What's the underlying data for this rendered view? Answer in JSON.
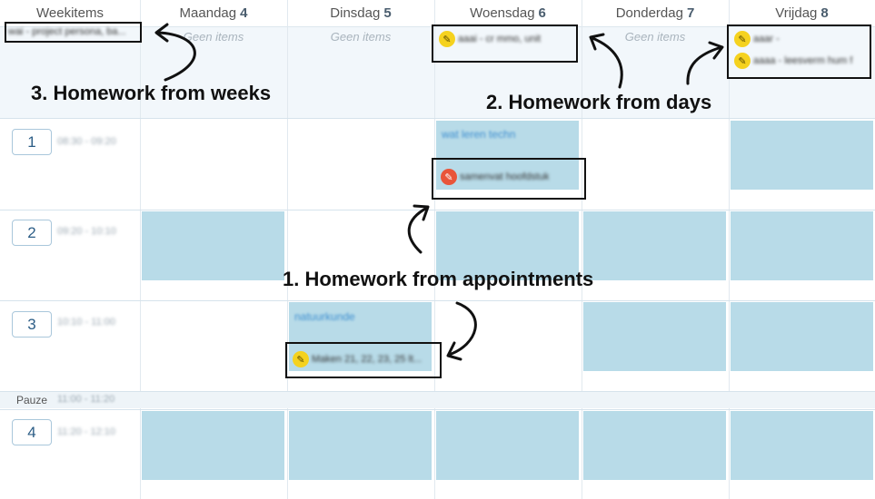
{
  "header": {
    "weekitems": "Weekitems",
    "days": [
      {
        "name": "Maandag",
        "num": "4"
      },
      {
        "name": "Dinsdag",
        "num": "5"
      },
      {
        "name": "Woensdag",
        "num": "6"
      },
      {
        "name": "Donderdag",
        "num": "7"
      },
      {
        "name": "Vrijdag",
        "num": "8"
      }
    ]
  },
  "week_homework": "wai - project persona, ba...",
  "empty_label": "Geen items",
  "day_homework": {
    "woensdag": "aaai - cr mmo, unit",
    "vrijdag": [
      "aaar -",
      "aaaa - leesverm hum f"
    ]
  },
  "periods": [
    {
      "num": "1",
      "time": "08:30 - 09:20"
    },
    {
      "num": "2",
      "time": "09:20 - 10:10"
    },
    {
      "num": "3",
      "time": "10:10 - 11:00"
    },
    {
      "num": "4",
      "time": "11:20 - 12:10"
    }
  ],
  "pauze": {
    "label": "Pauze",
    "time": "11:00 - 11:20"
  },
  "appointments": {
    "woensdag_1_title": "wat leren techn",
    "woensdag_1_homework": "samenvat hoofdstuk",
    "dinsdag_3_title": "natuurkunde",
    "dinsdag_3_homework": "Maken 21, 22, 23, 25 lt..."
  },
  "annotations": {
    "weeks": "3. Homework from weeks",
    "days": "2. Homework from days",
    "appointments": "1. Homework from appointments"
  },
  "colors": {
    "appointment": "#b8dbe8",
    "homework_icon": "#f5d21f",
    "homework_icon_overdue": "#e9553a"
  }
}
